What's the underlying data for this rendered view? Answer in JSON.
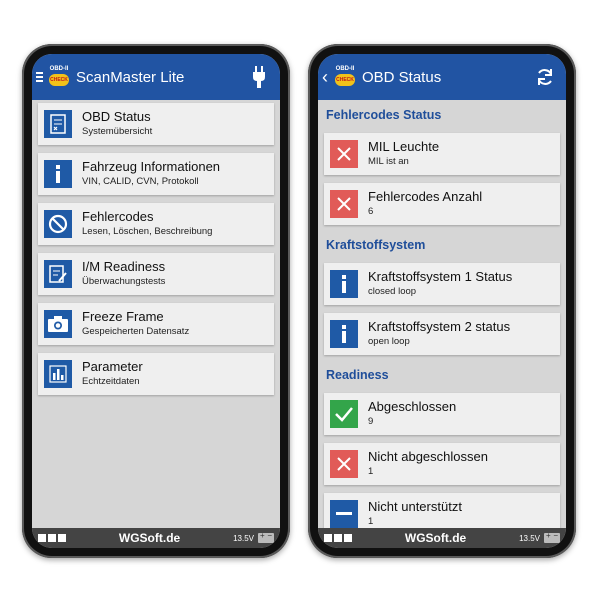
{
  "left": {
    "title": "ScanMaster Lite",
    "logo_top": "OBD-II",
    "logo_badge": "CHECK",
    "menu": [
      {
        "title": "OBD Status",
        "subtitle": "Systemübersicht",
        "icon": "checklist-icon"
      },
      {
        "title": "Fahrzeug Informationen",
        "subtitle": "VIN, CALID, CVN, Protokoll",
        "icon": "info-icon"
      },
      {
        "title": "Fehlercodes",
        "subtitle": "Lesen, Löschen, Beschreibung",
        "icon": "prohibited-icon"
      },
      {
        "title": "I/M Readiness",
        "subtitle": "Überwachungstests",
        "icon": "edit-checklist-icon"
      },
      {
        "title": "Freeze Frame",
        "subtitle": "Gespeicherten Datensatz",
        "icon": "camera-icon"
      },
      {
        "title": "Parameter",
        "subtitle": "Echtzeitdaten",
        "icon": "bar-chart-icon"
      }
    ],
    "footer_brand": "WGSoft.de",
    "footer_voltage": "13.5V"
  },
  "right": {
    "title": "OBD Status",
    "logo_top": "OBD-II",
    "logo_badge": "CHECK",
    "sections": [
      {
        "label": "Fehlercodes Status"
      },
      {
        "label": "Kraftstoffsystem"
      },
      {
        "label": "Readiness"
      }
    ],
    "items": [
      {
        "title": "MIL Leuchte",
        "subtitle": "MIL ist an",
        "icon": "close-icon",
        "color": "#e15b58"
      },
      {
        "title": "Fehlercodes Anzahl",
        "subtitle": "6",
        "icon": "close-icon",
        "color": "#e15b58"
      },
      {
        "title": "Kraftstoffsystem 1 Status",
        "subtitle": "closed loop",
        "icon": "info-icon",
        "color": "#1f5aa6"
      },
      {
        "title": "Kraftstoffsystem 2 status",
        "subtitle": "open loop",
        "icon": "info-icon",
        "color": "#1f5aa6"
      },
      {
        "title": "Abgeschlossen",
        "subtitle": "9",
        "icon": "check-icon",
        "color": "#33a54a"
      },
      {
        "title": "Nicht abgeschlossen",
        "subtitle": "1",
        "icon": "close-icon",
        "color": "#e15b58"
      },
      {
        "title": "Nicht unterstützt",
        "subtitle": "1",
        "icon": "minus-icon",
        "color": "#1f5aa6"
      }
    ],
    "footer_brand": "WGSoft.de",
    "footer_voltage": "13.5V"
  },
  "colors": {
    "appbar": "#2154a3",
    "accent_blue": "#1f5aa6",
    "error_red": "#e15b58",
    "ok_green": "#33a54a"
  }
}
